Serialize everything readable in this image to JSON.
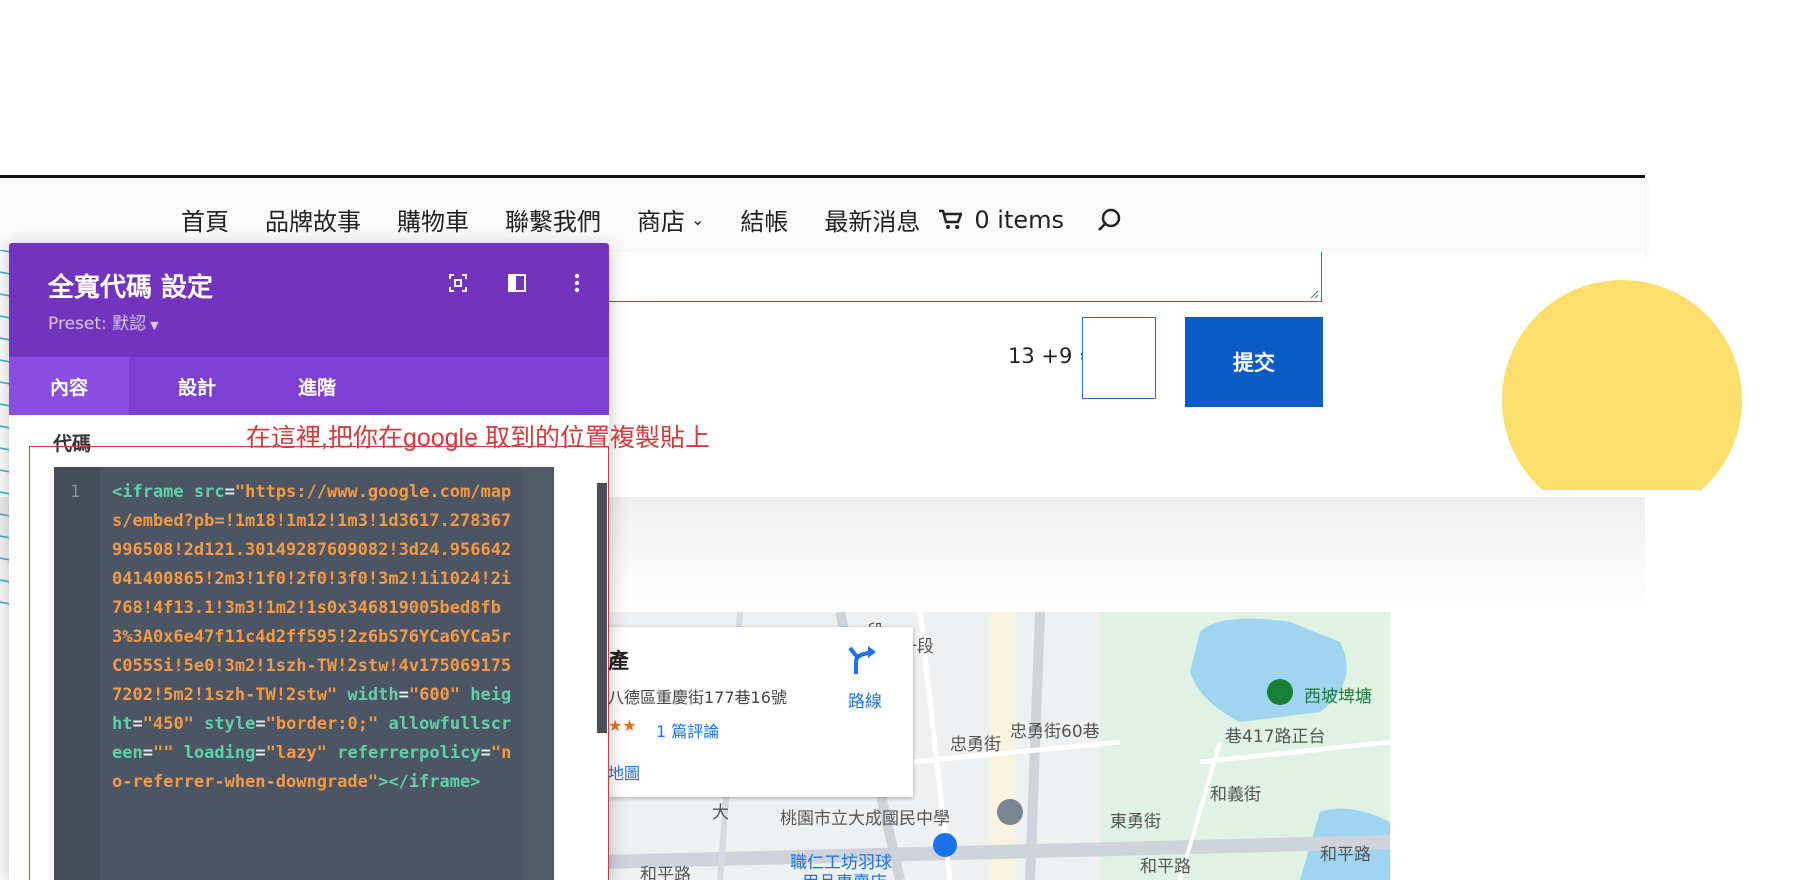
{
  "nav": {
    "items": [
      "首頁",
      "品牌故事",
      "購物車",
      "聯繫我們",
      "商店",
      "結帳",
      "最新消息"
    ],
    "cart_label": "0 items"
  },
  "form": {
    "captcha_label": "13 +9 =",
    "captcha_value": "",
    "submit_label": "提交"
  },
  "map": {
    "place_name": "產",
    "address": "八德區重慶街177巷16號",
    "stars": "★★",
    "reviews": "1 篇評論",
    "bigger_map": "地圖",
    "directions_label": "路線",
    "labels": [
      "西坡埤塘",
      "忠勇街60巷",
      "忠勇街",
      "和義街",
      "桃園市立大成國民中學",
      "東勇街",
      "和平路",
      "和平路",
      "和平路",
      "職仁工坊羽球",
      "用品專賣店",
      "大",
      "一段",
      "一段",
      "巷417路正台"
    ]
  },
  "panel": {
    "title": "全寬代碼 設定",
    "preset": "Preset: 默認",
    "tabs": [
      "內容",
      "設計",
      "進階"
    ],
    "field_label": "代碼",
    "line_number": "1",
    "code": {
      "tag_open": "<iframe",
      "src_attr": "src",
      "src_value": "\"https://www.google.com/maps/embed?pb=!1m18!1m12!1m3!1d3617.278367996508!2d121.30149287609082!3d24.956642041400865!2m3!1f0!2f0!3f0!3m2!1i1024!2i768!4f13.1!3m3!1m2!1s0x346819005bed8fb3%3A0x6e47f11c4d2ff595!2z6bS76YCa6YCa5rC055Si!5e0!3m2!1szh-TW!2stw!4v1750691757202!5m2!1szh-TW!2stw\"",
      "width_attr": "width",
      "width_value": "\"600\"",
      "height_attr": "height",
      "height_value": "\"450\"",
      "style_attr": "style",
      "style_value": "\"border:0;\"",
      "allow_attr": "allowfullscreen",
      "allow_value": "\"\"",
      "loading_attr": "loading",
      "loading_value": "\"lazy\"",
      "ref_attr": "referrerpolicy",
      "ref_value": "\"no-referrer-when-downgrade\"",
      "tag_close": "></iframe>"
    }
  },
  "annotation": "在這裡,把你在google 取到的位置複製貼上",
  "colors": {
    "panel_header": "#7233be",
    "panel_tabs": "#7c3fd2",
    "submit": "#0a5bc4",
    "annotation": "#d33a3a",
    "accent_yellow": "#fadf6c"
  }
}
